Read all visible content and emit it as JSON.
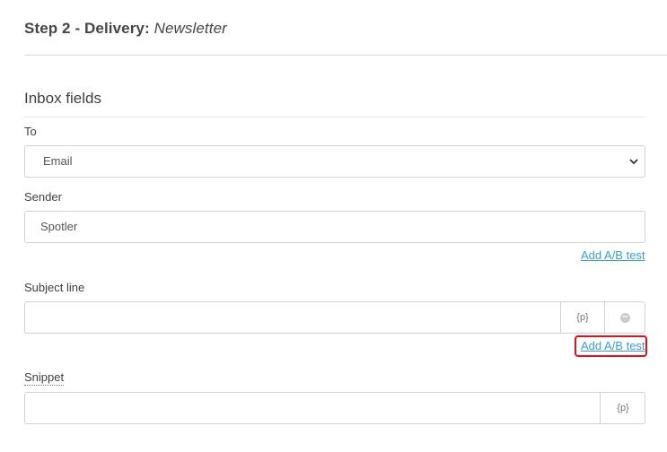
{
  "header": {
    "step_label": "Step 2 - Delivery:",
    "step_name": "Newsletter"
  },
  "section": {
    "title": "Inbox fields"
  },
  "to": {
    "label": "To",
    "selected": "Email"
  },
  "sender": {
    "label": "Sender",
    "value": "Spotler",
    "ab_link": "Add A/B test"
  },
  "subject": {
    "label": "Subject line",
    "value": "",
    "placeholder_addon": "{p}",
    "ab_link": "Add A/B test"
  },
  "snippet": {
    "label": "Snippet",
    "value": "",
    "placeholder_addon": "{p}"
  },
  "colors": {
    "link": "#3a9fd6",
    "highlight": "#e3101c"
  },
  "icons": [
    "chevron-down-icon",
    "emoji-icon"
  ]
}
